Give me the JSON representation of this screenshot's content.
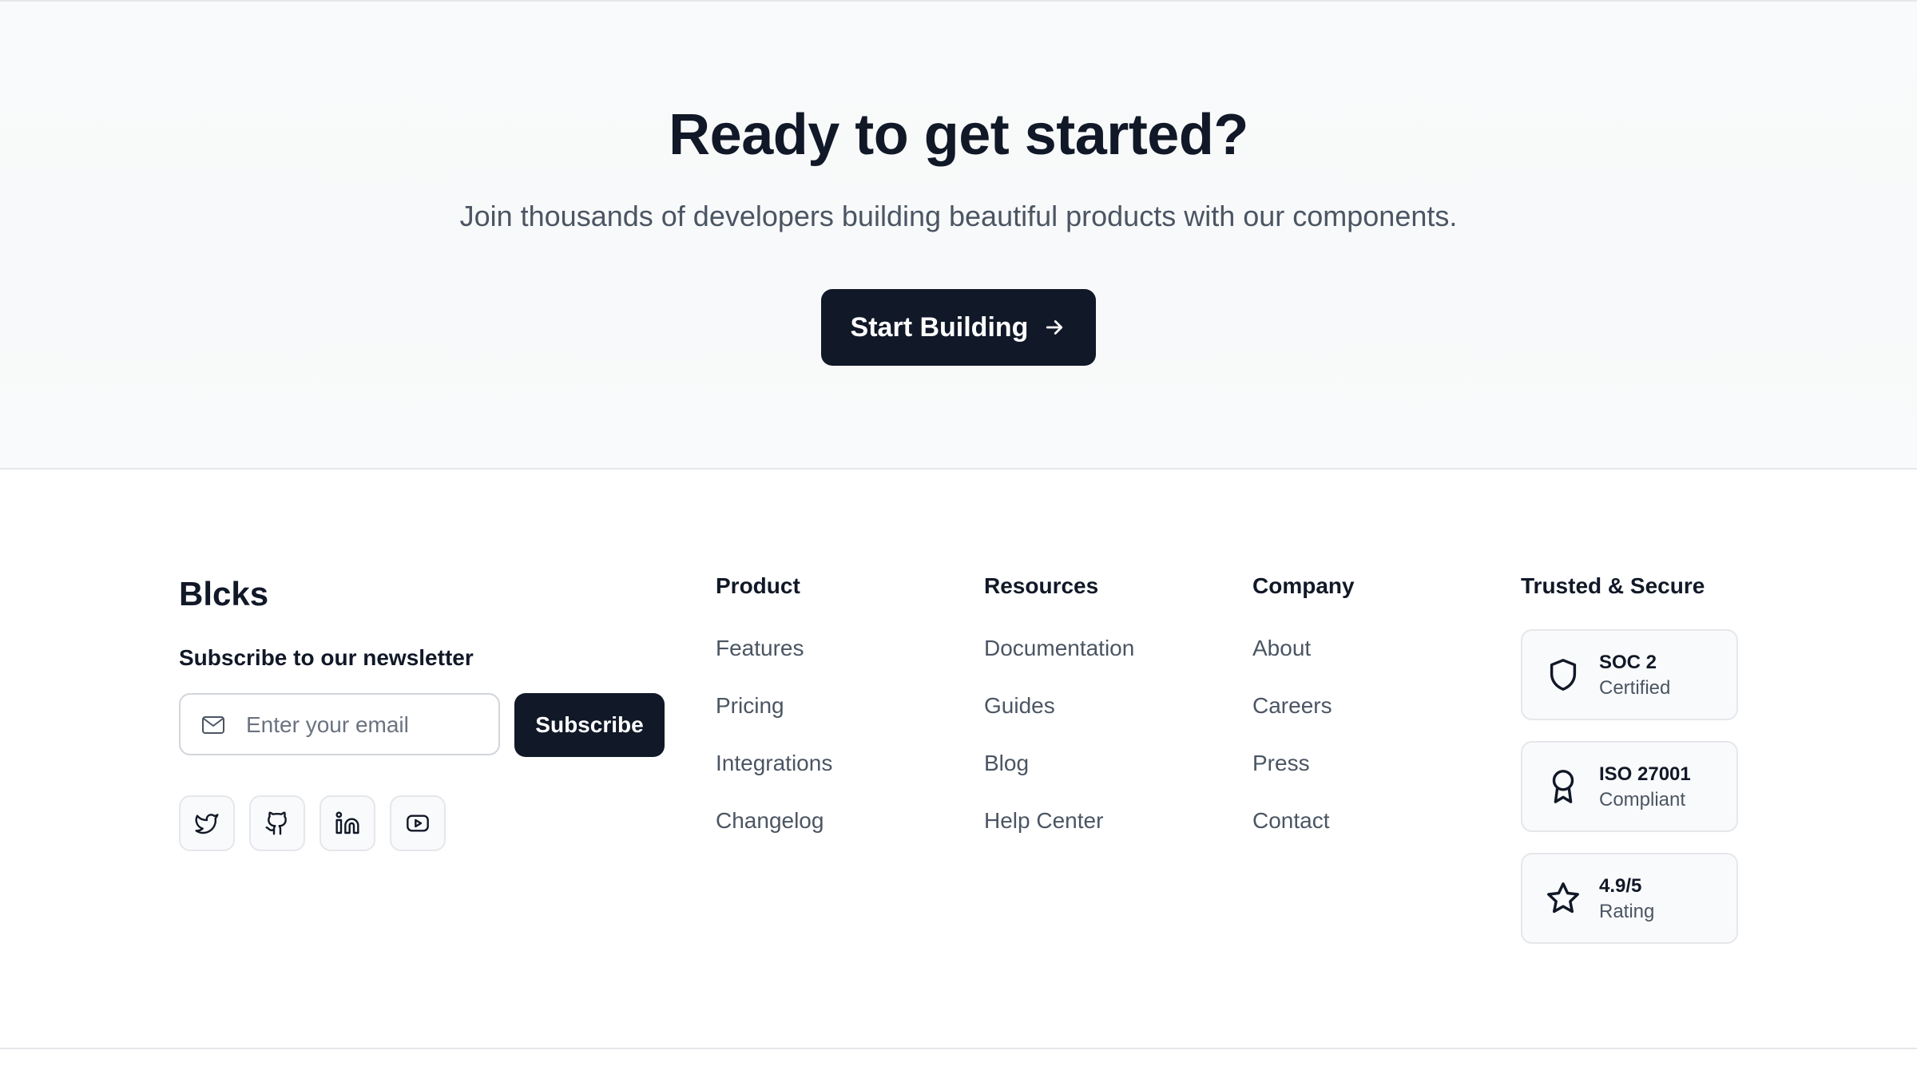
{
  "cta": {
    "title": "Ready to get started?",
    "subtitle": "Join thousands of developers building beautiful products with our components.",
    "button_label": "Start Building",
    "button_icon": "arrow-right-icon"
  },
  "footer": {
    "brand": "Blcks",
    "newsletter": {
      "title": "Subscribe to our newsletter",
      "email_placeholder": "Enter your email",
      "email_value": "",
      "subscribe_label": "Subscribe",
      "email_icon": "mail-icon"
    },
    "social_icons": [
      "twitter-icon",
      "github-icon",
      "linkedin-icon",
      "youtube-icon"
    ],
    "columns": [
      {
        "title": "Product",
        "links": [
          "Features",
          "Pricing",
          "Integrations",
          "Changelog"
        ]
      },
      {
        "title": "Resources",
        "links": [
          "Documentation",
          "Guides",
          "Blog",
          "Help Center"
        ]
      },
      {
        "title": "Company",
        "links": [
          "About",
          "Careers",
          "Press",
          "Contact"
        ]
      }
    ],
    "trust": {
      "title": "Trusted & Secure",
      "badges": [
        {
          "title": "SOC 2",
          "subtitle": "Certified",
          "icon": "shield-icon"
        },
        {
          "title": "ISO 27001",
          "subtitle": "Compliant",
          "icon": "award-icon"
        },
        {
          "title": "4.9/5",
          "subtitle": "Rating",
          "icon": "star-icon"
        }
      ]
    }
  },
  "colors": {
    "primary": "#111827",
    "text_muted": "#4b5563",
    "border": "#e5e7eb",
    "surface": "#f9fafb"
  }
}
